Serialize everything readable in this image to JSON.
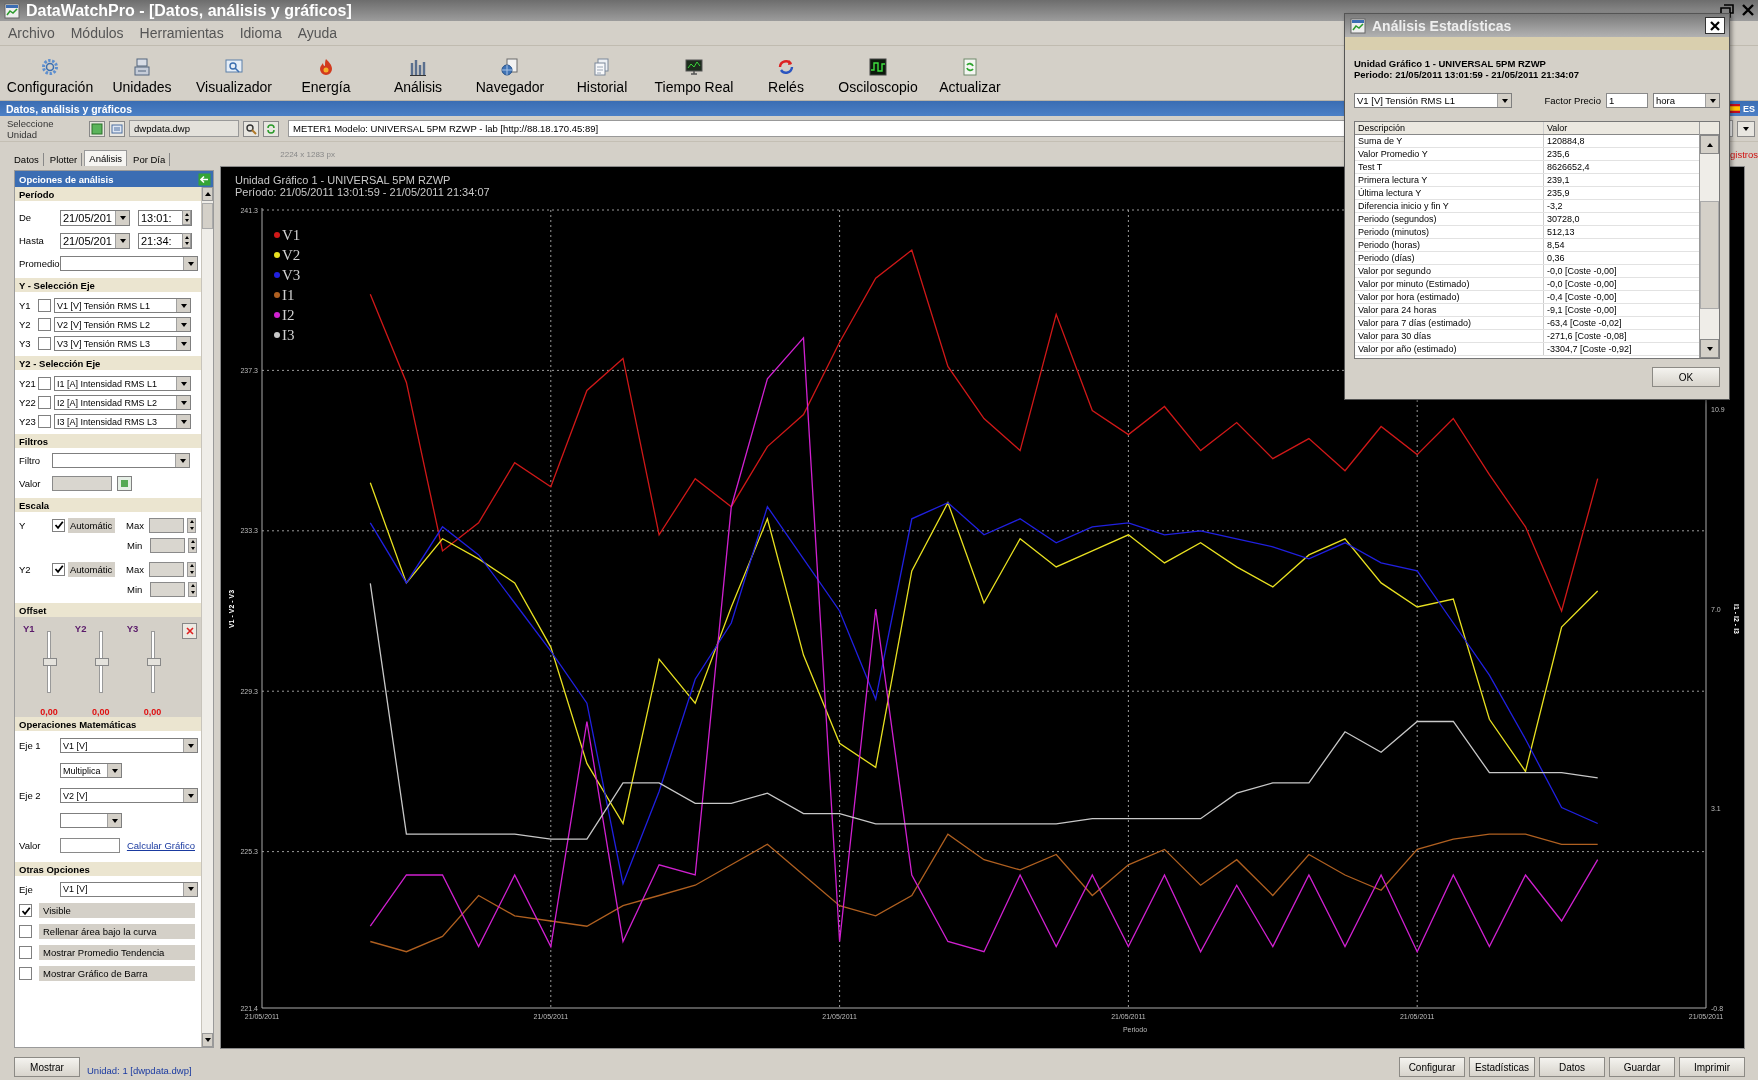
{
  "window": {
    "title": "DataWatchPro - [Datos, análisis y gráficos]"
  },
  "menu": [
    "Archivo",
    "Módulos",
    "Herramientas",
    "Idioma",
    "Ayuda"
  ],
  "toolbar": [
    "Configuración",
    "Unidades",
    "Visualizador",
    "Energía",
    "Análisis",
    "Navegador",
    "Historial",
    "Tiempo Real",
    "Relés",
    "Osciloscopio",
    "Actualizar"
  ],
  "panel": {
    "title": "Datos, análisis y gráficos",
    "language": "ES"
  },
  "unit_bar": {
    "label": "Seleccione Unidad",
    "file": "dwpdata.dwp",
    "device": "METER1  Modelo: UNIVERSAL 5PM RZWP - lab [http://88.18.170.45:89]"
  },
  "tabs": [
    {
      "label": "Datos",
      "selected": false
    },
    {
      "label": "Plotter",
      "selected": false
    },
    {
      "label": "Análisis",
      "selected": true
    },
    {
      "label": "Por Día",
      "selected": false
    }
  ],
  "image_size": "2224 x 1283 px",
  "records_link": "gistros",
  "options": {
    "title": "Opciones de análisis",
    "period": {
      "heading": "Período",
      "rows": [
        {
          "label": "De",
          "date": "21/05/201",
          "time": "13:01:"
        },
        {
          "label": "Hasta",
          "date": "21/05/201",
          "time": "21:34:"
        }
      ],
      "average_label": "Promedio"
    },
    "y_axis": {
      "heading": "Y - Selección Eje",
      "rows": [
        {
          "label": "Y1",
          "checked": false,
          "value": "V1 [V] Tensión RMS L1"
        },
        {
          "label": "Y2",
          "checked": false,
          "value": "V2 [V] Tensión RMS L2"
        },
        {
          "label": "Y3",
          "checked": false,
          "value": "V3 [V] Tensión RMS L3"
        }
      ]
    },
    "y2_axis": {
      "heading": "Y2 - Selección Eje",
      "rows": [
        {
          "label": "Y21",
          "checked": false,
          "value": "I1 [A] Intensidad RMS L1"
        },
        {
          "label": "Y22",
          "checked": false,
          "value": "I2 [A] Intensidad RMS L2"
        },
        {
          "label": "Y23",
          "checked": false,
          "value": "I3 [A] Intensidad RMS L3"
        }
      ]
    },
    "filters": {
      "heading": "Filtros",
      "filter_label": "Filtro",
      "value_label": "Valor"
    },
    "scale": {
      "heading": "Escala",
      "rows": [
        {
          "label": "Y",
          "auto": true,
          "auto_label": "Automátic",
          "max_label": "Max",
          "min_label": "Min"
        },
        {
          "label": "Y2",
          "auto": true,
          "auto_label": "Automátic",
          "max_label": "Max",
          "min_label": "Min"
        }
      ]
    },
    "offset": {
      "heading": "Offset",
      "sliders": [
        {
          "label": "Y1",
          "level": 0.5,
          "reading": "0,00"
        },
        {
          "label": "Y2",
          "level": 0.5,
          "reading": "0,00"
        },
        {
          "label": "Y3",
          "level": 0.5,
          "reading": "0,00"
        }
      ]
    },
    "math": {
      "heading": "Operaciones Matemáticas",
      "axis1_label": "Eje 1",
      "axis1": "V1 [V]",
      "operation": "Multiplica",
      "axis2_label": "Eje 2",
      "axis2": "V2 [V]",
      "value_label": "Valor",
      "link": "Calcular Gráfico"
    },
    "other": {
      "heading": "Otras Opciones",
      "axis_label": "Eje",
      "axis": "V1 [V]",
      "checks": [
        {
          "label": "Visible",
          "checked": true
        },
        {
          "label": "Rellenar área bajo la curva",
          "checked": false
        },
        {
          "label": "Mostrar Promedio Tendencia",
          "checked": false
        },
        {
          "label": "Mostrar Gráfico de Barra",
          "checked": false
        }
      ]
    }
  },
  "chart": {
    "heading": "Unidad Gráfico 1 - UNIVERSAL 5PM RZWP",
    "period": "Período: 21/05/2011 13:01:59 - 21/05/2011 21:34:07",
    "y2label": "I1 - I2 - I3",
    "x_labels": [
      "21/05/2011",
      "21/05/2011",
      "21/05/2011",
      "21/05/2011",
      "21/05/2011",
      "21/05/2011"
    ],
    "chart_data": {
      "type": "line",
      "grid": true,
      "legend": "upper left",
      "xlabel": "Periodo",
      "ylabel": "V1 - V2 - V3",
      "ylim": [
        221.4,
        241.3
      ],
      "y2lim": [
        -0.8,
        14.8
      ],
      "yticks": [
        {
          "value": 221.4,
          "label": "221.4"
        },
        {
          "value": 225.3,
          "label": "225.3"
        },
        {
          "value": 229.3,
          "label": "229.3"
        },
        {
          "value": 233.3,
          "label": "233.3"
        },
        {
          "value": 237.3,
          "label": "237.3"
        },
        {
          "value": 241.3,
          "label": "241.3"
        }
      ],
      "y2ticks": [
        {
          "value": -0.8,
          "label": "-0.8"
        },
        {
          "value": 3.1,
          "label": "3.1"
        },
        {
          "value": 7.0,
          "label": "7.0"
        },
        {
          "value": 10.9,
          "label": "10.9"
        }
      ],
      "series": [
        {
          "name": "V1",
          "color": "#d01818",
          "axis": "y",
          "values": [
            null,
            null,
            null,
            239.2,
            237.0,
            232.8,
            233.5,
            235.0,
            234.4,
            236.8,
            237.6,
            233.2,
            234.6,
            233.9,
            235.4,
            236.2,
            238.0,
            239.6,
            240.3,
            237.4,
            236.1,
            235.3,
            238.7,
            236.3,
            235.7,
            236.4,
            235.3,
            236.0,
            235.1,
            235.6,
            234.8,
            235.9,
            235.2,
            236.1,
            234.7,
            233.4,
            231.3,
            234.6,
            null,
            null,
            null
          ]
        },
        {
          "name": "V2",
          "color": "#e8e020",
          "axis": "y",
          "values": [
            null,
            null,
            null,
            234.5,
            232.0,
            233.1,
            232.6,
            232.0,
            230.4,
            227.5,
            226.0,
            230.1,
            229.0,
            231.4,
            233.6,
            230.2,
            228.0,
            227.4,
            232.3,
            234.0,
            231.5,
            233.1,
            232.4,
            232.8,
            233.2,
            232.5,
            233.0,
            232.4,
            231.9,
            232.7,
            233.1,
            232.0,
            231.4,
            231.6,
            228.6,
            227.3,
            230.9,
            231.8,
            null,
            null,
            null
          ]
        },
        {
          "name": "V3",
          "color": "#2020e0",
          "axis": "y",
          "values": [
            null,
            null,
            null,
            233.5,
            232.0,
            233.4,
            232.7,
            231.5,
            230.3,
            229.0,
            224.5,
            226.8,
            229.6,
            231.0,
            233.9,
            232.6,
            231.3,
            229.1,
            233.6,
            234.0,
            233.2,
            233.6,
            233.0,
            233.4,
            233.5,
            233.2,
            233.3,
            233.1,
            232.9,
            232.6,
            233.0,
            232.5,
            232.3,
            231.0,
            229.7,
            228.1,
            226.4,
            226.0,
            null,
            null,
            null
          ]
        },
        {
          "name": "I1",
          "color": "#b06020",
          "axis": "y2",
          "values": [
            null,
            null,
            null,
            0.5,
            0.3,
            0.6,
            1.4,
            1.0,
            0.9,
            0.8,
            1.2,
            1.4,
            1.6,
            2.0,
            2.4,
            1.8,
            1.2,
            1.0,
            1.4,
            2.6,
            2.1,
            1.9,
            2.2,
            1.4,
            2.0,
            2.3,
            1.6,
            2.1,
            1.4,
            2.2,
            1.8,
            1.5,
            2.3,
            2.5,
            2.6,
            2.6,
            2.4,
            2.4,
            null,
            null,
            null
          ]
        },
        {
          "name": "I2",
          "color": "#d020d0",
          "axis": "y2",
          "values": [
            null,
            null,
            null,
            0.8,
            1.8,
            1.8,
            0.4,
            1.8,
            0.4,
            4.8,
            0.5,
            2.0,
            1.8,
            9.0,
            11.5,
            12.3,
            0.5,
            7.0,
            1.8,
            0.5,
            0.3,
            1.8,
            0.4,
            1.8,
            0.4,
            1.8,
            0.3,
            1.6,
            0.4,
            1.8,
            0.4,
            1.8,
            0.3,
            1.8,
            0.4,
            1.8,
            0.9,
            2.1,
            null,
            null,
            null
          ]
        },
        {
          "name": "I3",
          "color": "#c8c8c8",
          "axis": "y2",
          "values": [
            null,
            null,
            null,
            7.5,
            2.6,
            2.6,
            2.6,
            2.6,
            2.5,
            2.5,
            3.6,
            3.6,
            3.2,
            3.2,
            3.4,
            3.0,
            3.0,
            2.8,
            2.8,
            2.8,
            2.8,
            2.8,
            2.8,
            2.9,
            2.9,
            2.9,
            2.9,
            3.4,
            3.6,
            3.6,
            4.6,
            4.2,
            4.8,
            4.8,
            3.8,
            3.8,
            3.8,
            3.7,
            null,
            null,
            null
          ]
        }
      ]
    }
  },
  "footer": {
    "show_button": "Mostrar",
    "unit_link": "Unidad: 1 [dwpdata.dwp]",
    "buttons": [
      "Configurar",
      "Estadísticas",
      "Datos",
      "Guardar",
      "Imprimir"
    ]
  },
  "dialog": {
    "title": "Análisis Estadísticas",
    "heading": "Unidad Gráfico 1 - UNIVERSAL 5PM RZWP",
    "period": "Periodo: 21/05/2011 13:01:59 - 21/05/2011 21:34:07",
    "channel": "V1 [V] Tensión RMS L1",
    "price_label": "Factor Precio",
    "price": "1",
    "unit": "hora",
    "columns": [
      "Descripción",
      "Valor"
    ],
    "rows": [
      {
        "description": "Suma de Y",
        "value": "120884,8"
      },
      {
        "description": "Valor Promedio Y",
        "value": "235,6"
      },
      {
        "description": "Test T",
        "value": "8626652,4"
      },
      {
        "description": "Primera lectura Y",
        "value": "239,1"
      },
      {
        "description": "Última lectura Y",
        "value": "235,9"
      },
      {
        "description": "Diferencia inicio y fin Y",
        "value": "-3,2"
      },
      {
        "description": "Periodo (segundos)",
        "value": "30728,0"
      },
      {
        "description": "Periodo (minutos)",
        "value": "512,13"
      },
      {
        "description": "Periodo (horas)",
        "value": "8,54"
      },
      {
        "description": "Periodo (días)",
        "value": "0,36"
      },
      {
        "description": "Valor por segundo",
        "value": "-0,0 [Coste -0,00]"
      },
      {
        "description": "Valor por minuto (Estimado)",
        "value": "-0,0 [Coste -0,00]"
      },
      {
        "description": "Valor por hora (estimado)",
        "value": "-0,4 [Coste -0,00]"
      },
      {
        "description": "Valor para 24 horas",
        "value": "-9,1 [Coste -0,00]"
      },
      {
        "description": "Valor para 7 días (estimado)",
        "value": "-63,4 [Coste -0,02]"
      },
      {
        "description": "Valor para 30 días",
        "value": "-271,6 [Coste -0,08]"
      },
      {
        "description": "Valor por año (estimado)",
        "value": "-3304,7 [Coste -0,92]"
      }
    ],
    "ok": "OK"
  }
}
